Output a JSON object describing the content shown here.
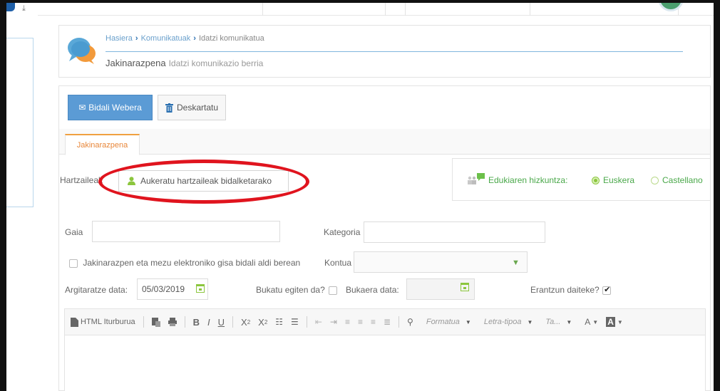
{
  "breadcrumb": {
    "items": [
      "Hasiera",
      "Komunikatuak",
      "Idatzi komunikatua"
    ]
  },
  "header": {
    "title": "Jakinarazpena",
    "subtitle": "Idatzi komunikazio berria"
  },
  "toolbar": {
    "send_label": "Bidali Webera",
    "discard_label": "Deskartatu"
  },
  "tabs": [
    {
      "label": "Jakinarazpena",
      "active": true
    }
  ],
  "recipients": {
    "label": "Hartzaileak",
    "button_label": "Aukeratu hartzaileak bidalketarako"
  },
  "language": {
    "label": "Edukiaren hizkuntza:",
    "options": [
      {
        "label": "Euskera",
        "selected": true
      },
      {
        "label": "Castellano",
        "selected": false
      }
    ]
  },
  "form": {
    "subject_label": "Gaia",
    "subject_value": "",
    "category_label": "Kategoria",
    "category_value": "",
    "also_email_label": "Jakinarazpen eta mezu elektroniko gisa bidali aldi berean",
    "also_email_checked": false,
    "account_label": "Kontua",
    "account_value": "",
    "publish_date_label": "Argitaratze data:",
    "publish_date_value": "05/03/2019",
    "finished_label": "Bukatu egiten da?",
    "finished_checked": false,
    "end_date_label": "Bukaera data:",
    "end_date_value": "",
    "can_reply_label": "Erantzun daiteke?",
    "can_reply_checked": true
  },
  "editor": {
    "html_source_label": "HTML Iturburua",
    "format_label": "Formatua",
    "font_label": "Letra-tipoa",
    "size_label": "Ta...",
    "text_color_label": "A",
    "bg_color_label": "A"
  },
  "colors": {
    "accent_blue": "#5b9bd5",
    "tab_orange": "#e8873a",
    "green": "#8cc63e",
    "annotation_red": "#e0141e"
  }
}
